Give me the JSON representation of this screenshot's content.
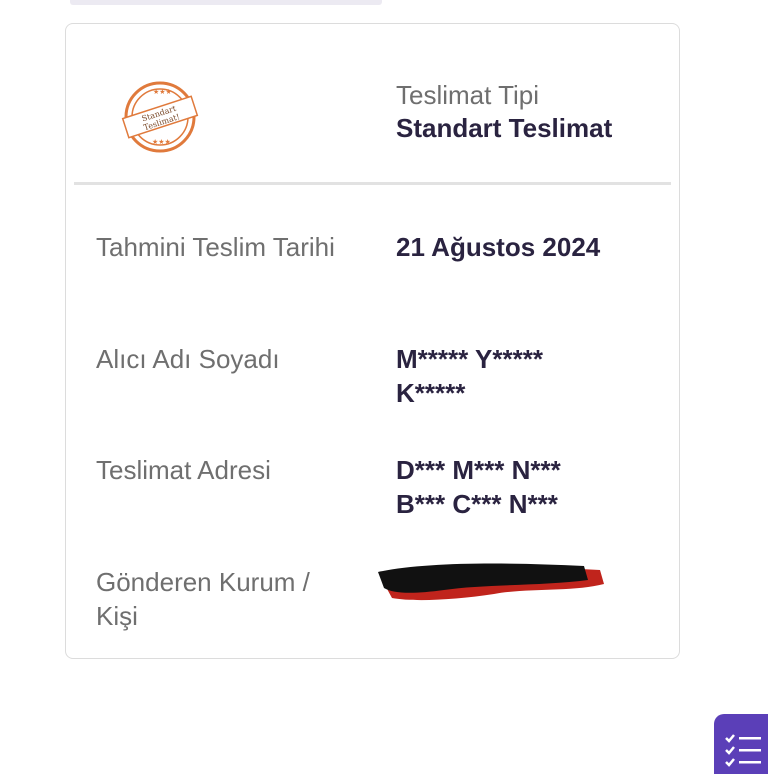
{
  "stamp": {
    "line1": "Standart",
    "line2": "Teslimat!"
  },
  "delivery_type": {
    "label": "Teslimat Tipi",
    "value": "Standart Teslimat"
  },
  "rows": [
    {
      "label": "Tahmini Teslim Tarihi",
      "value": "21 Ağustos 2024"
    },
    {
      "label": "Alıcı Adı Soyadı",
      "value": "M***** Y***** K*****"
    },
    {
      "label": "Teslimat Adresi",
      "value": "D*** M*** N*** B*** C*** N***"
    },
    {
      "label": "Gönderen Kurum / Kişi",
      "value": ""
    }
  ],
  "colors": {
    "accent": "#5b3fb8",
    "stamp": "#e07a3c",
    "value_text": "#2a2340",
    "label_text": "#6f6f6f"
  },
  "fab": {
    "icon": "checklist-icon"
  }
}
